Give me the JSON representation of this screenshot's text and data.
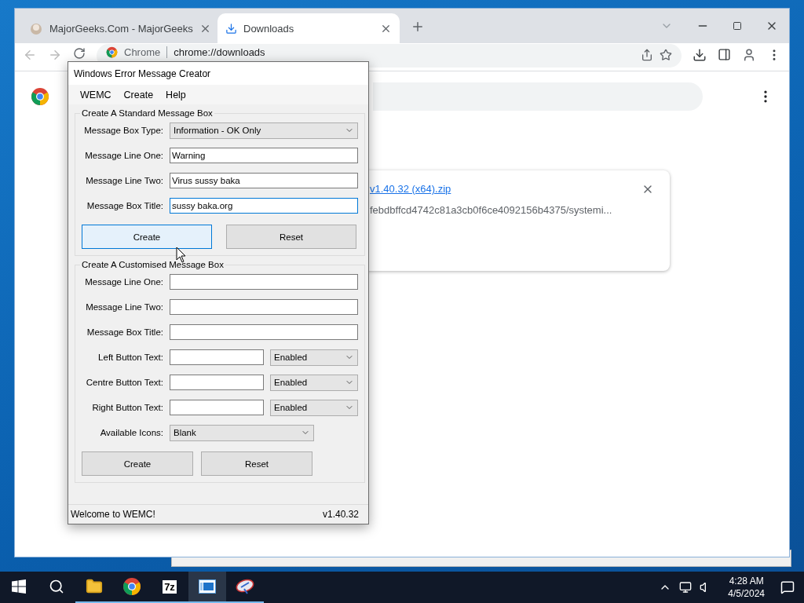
{
  "browser": {
    "tabs": [
      {
        "title": "MajorGeeks.Com - MajorGeeks",
        "selected": false
      },
      {
        "title": "Downloads",
        "selected": true
      }
    ],
    "address": {
      "chip": "Chrome",
      "url": "chrome://downloads"
    },
    "download": {
      "file_name": "v1.40.32 (x64).zip",
      "source": "febdbffcd4742c81a3cb0f6ce4092156b4375/systemi..."
    }
  },
  "wemc": {
    "title": "Windows Error Message Creator",
    "menu": [
      "WEMC",
      "Create",
      "Help"
    ],
    "standard": {
      "legend": "Create A Standard Message Box",
      "rows": [
        {
          "kind": "select",
          "label": "Message Box Type:",
          "value": "Information - OK Only"
        },
        {
          "kind": "input",
          "label": "Message Line One:",
          "value": "Warning",
          "focused": false
        },
        {
          "kind": "input",
          "label": "Message Line Two:",
          "value": "Virus sussy baka",
          "focused": false
        },
        {
          "kind": "input",
          "label": "Message Box Title:",
          "value": "sussy baka.org",
          "focused": true
        }
      ],
      "buttons": [
        {
          "label": "Create",
          "hovered": true
        },
        {
          "label": "Reset",
          "hovered": false
        }
      ]
    },
    "custom": {
      "legend": "Create A Customised Message Box",
      "rows": [
        {
          "kind": "input",
          "label": "Message Line One:",
          "focused": false
        },
        {
          "kind": "input",
          "label": "Message Line Two:",
          "focused": false
        },
        {
          "kind": "input",
          "label": "Message Box Title:",
          "focused": false
        },
        {
          "kind": "input_select",
          "label": "Left Button Text:",
          "option": "Enabled"
        },
        {
          "kind": "input_select",
          "label": "Centre Button Text:",
          "option": "Enabled"
        },
        {
          "kind": "input_select",
          "label": "Right Button Text:",
          "option": "Enabled"
        },
        {
          "kind": "short_select",
          "label": "Available Icons:",
          "value": "Blank"
        }
      ],
      "buttons": [
        {
          "label": "Create",
          "hovered": false
        },
        {
          "label": "Reset",
          "hovered": false
        }
      ]
    },
    "status": {
      "message": "Welcome to WEMC!",
      "version": "v1.40.32"
    }
  },
  "taskbar": {
    "apps": [
      {
        "kind": "folder",
        "active": false
      },
      {
        "kind": "chrome",
        "active": false
      },
      {
        "kind": "archiver",
        "label": "7z",
        "active": false
      },
      {
        "kind": "window",
        "active": true
      },
      {
        "kind": "satellite",
        "active": false
      }
    ],
    "clock": {
      "time": "4:28 AM",
      "date": "4/5/2024"
    }
  }
}
